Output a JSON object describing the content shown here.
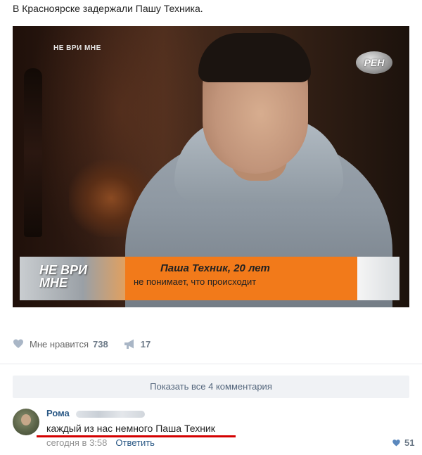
{
  "post": {
    "text": "В Красноярске задержали Пашу Техника."
  },
  "video": {
    "corner_logo": "НЕ ВРИ МНЕ",
    "channel_logo": "РЕН",
    "banner_logo": "НЕ ВРИ\nМНЕ",
    "banner_name": "Паша Техник, 20 лет",
    "banner_subtitle": "не понимает, что происходит"
  },
  "actions": {
    "like_label": "Мне нравится",
    "like_count": "738",
    "share_count": "17",
    "like_icon": "heart-icon",
    "share_icon": "megaphone-icon"
  },
  "comments": {
    "show_all_label": "Показать все 4 комментария",
    "items": [
      {
        "author": "Рома",
        "text": "каждый из нас немного Паша Техник",
        "time": "сегодня в 3:58",
        "reply_label": "Ответить",
        "likes": "51"
      }
    ]
  },
  "colors": {
    "link": "#2a5885",
    "accent_orange": "#f27a1a",
    "highlight_underline": "#d40000"
  }
}
